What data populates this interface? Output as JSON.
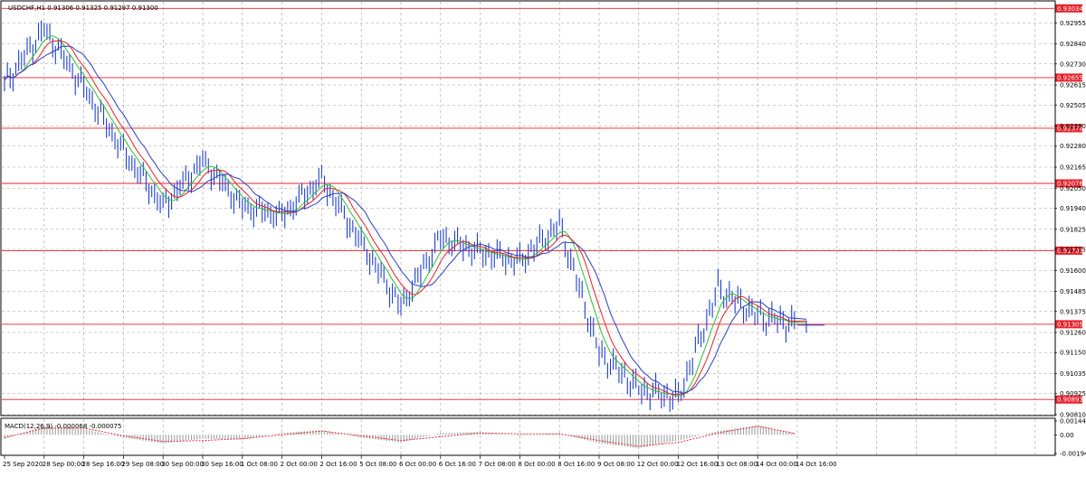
{
  "chart_title": "USDCHF,H1  0.91306 0.91325 0.91297 0.91300",
  "colors": {
    "background": "#ffffff",
    "grid": "#a0a0a0",
    "candle": "#1f3fd0",
    "level_line": "#e8202a",
    "level_label_bg": "#e8202a",
    "ma_fast": "#2fbf2f",
    "ma_mid": "#e8202a",
    "ma_slow": "#2b3fbf",
    "macd_hist": "#a8a8a8",
    "macd_signal": "#e8202a",
    "current_price_line": "#2b3fbf"
  },
  "chart_data": {
    "type": "line",
    "title": "USDCHF,H1  0.91306 0.91325 0.91297 0.91300",
    "xlabel": "",
    "ylabel": "",
    "ylim": [
      0.9081,
      0.9307
    ],
    "grid": true,
    "price_ticks": [
      "0.92955",
      "0.92840",
      "0.92730",
      "0.92615",
      "0.92505",
      "0.92390",
      "0.92280",
      "0.92165",
      "0.92050",
      "0.91940",
      "0.91825",
      "0.91715",
      "0.91600",
      "0.91485",
      "0.91375",
      "0.91260",
      "0.91150",
      "0.91035",
      "0.90925",
      "0.90810"
    ],
    "time_ticks": [
      "25 Sep 2020",
      "28 Sep 00:00",
      "28 Sep 16:00",
      "29 Sep 08:00",
      "30 Sep 00:00",
      "30 Sep 16:00",
      "1 Oct 08:00",
      "2 Oct 00:00",
      "2 Oct 16:00",
      "5 Oct 08:00",
      "6 Oct 00:00",
      "6 Oct 16:00",
      "7 Oct 08:00",
      "8 Oct 00:00",
      "8 Oct 16:00",
      "9 Oct 08:00",
      "12 Oct 00:00",
      "12 Oct 16:00",
      "13 Oct 08:00",
      "14 Oct 00:00",
      "14 Oct 16:00"
    ],
    "levels": [
      "0.93034",
      "0.92655",
      "0.92378",
      "0.92076",
      "0.91708",
      "0.91305",
      "0.90893"
    ],
    "series": [
      {
        "type": "line",
        "x": [
          0,
          1,
          2,
          3,
          4,
          5,
          6,
          7,
          8,
          9,
          10,
          11,
          12,
          13,
          14,
          15,
          16,
          17,
          18,
          19,
          20
        ],
        "values": [
          0.9262,
          0.9292,
          0.926,
          0.9225,
          0.9195,
          0.922,
          0.9195,
          0.919,
          0.921,
          0.9175,
          0.914,
          0.9178,
          0.917,
          0.9165,
          0.9185,
          0.9115,
          0.9095,
          0.909,
          0.915,
          0.9135,
          0.913
        ]
      }
    ],
    "macd": {
      "label": "MACD(12,26,9) -0.000068 -0.000075",
      "ticks": [
        "0.001444",
        "0.00",
        "-0.001949"
      ],
      "ylim": [
        -0.001949,
        0.001444
      ],
      "hist": [
        -0.0004,
        0.0009,
        0.0006,
        -0.0003,
        -0.0009,
        -0.0004,
        -0.0005,
        0.0002,
        0.0005,
        -0.0003,
        -0.0008,
        0.0002,
        0.0003,
        -0.0001,
        0.0002,
        -0.0009,
        -0.0014,
        -0.0006,
        0.0004,
        0.001,
        0.0001
      ],
      "signal": [
        -0.0003,
        0.0007,
        0.0007,
        -0.0001,
        -0.0007,
        -0.0006,
        -0.0004,
        0.0,
        0.0004,
        -0.0001,
        -0.0006,
        -0.0002,
        0.0002,
        0.0001,
        0.0001,
        -0.0006,
        -0.0012,
        -0.0008,
        0.0002,
        0.0009,
        0.0001
      ]
    }
  }
}
